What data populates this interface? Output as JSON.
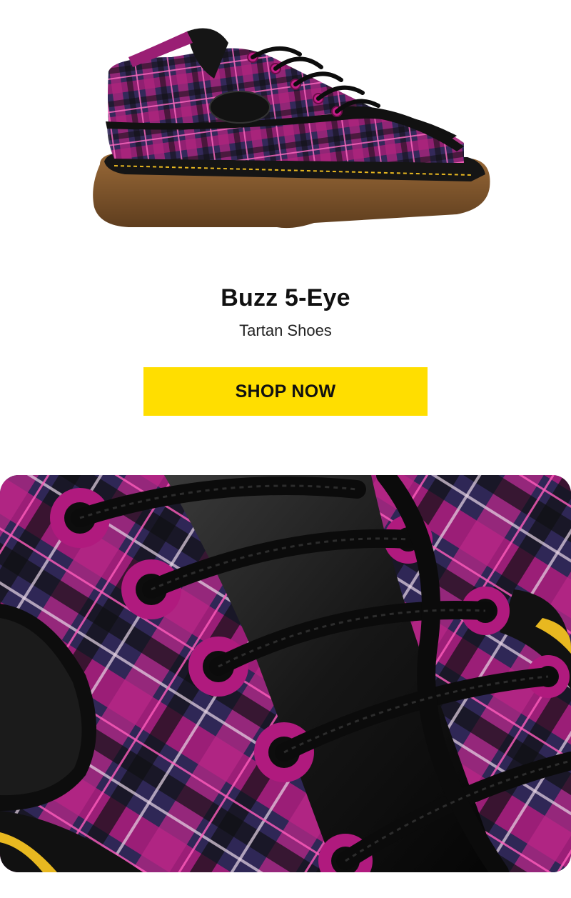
{
  "product": {
    "title": "Buzz 5-Eye",
    "subtitle": "Tartan Shoes"
  },
  "cta": {
    "label": "SHOP NOW",
    "color": "#ffde00"
  },
  "images": {
    "hero": "shoe-side-view-image",
    "detail": "tartan-lacing-closeup-image"
  },
  "colors": {
    "tartan_magenta": "#b0257e",
    "tartan_navy": "#332c5c",
    "leather_black": "#141414",
    "sole_gum": "#8a5a2e",
    "stitch_yellow": "#e8b820"
  }
}
